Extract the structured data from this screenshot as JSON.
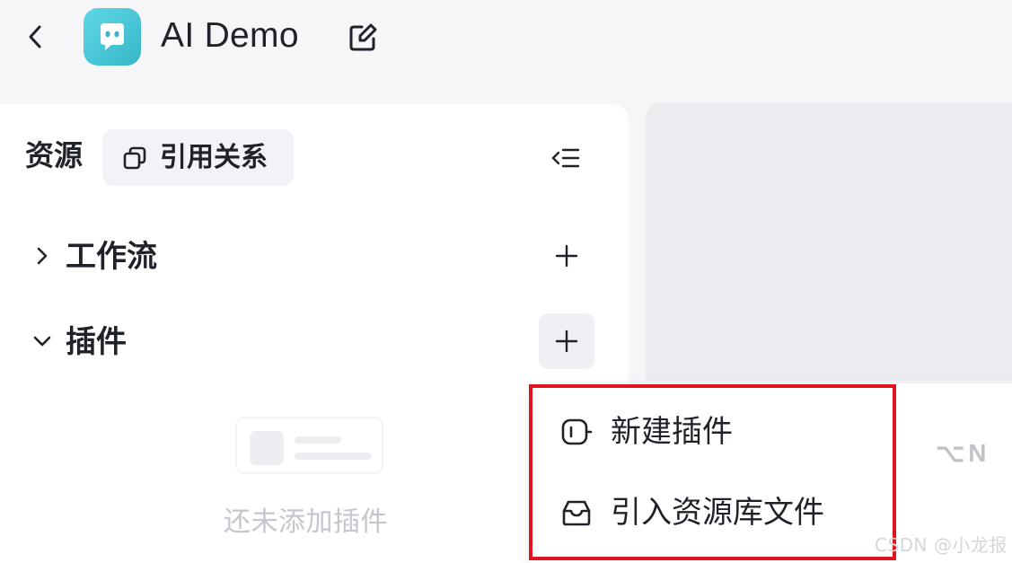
{
  "header": {
    "app_title": "AI Demo",
    "back_icon": "chevron-left-icon",
    "logo_icon": "chat-bot-logo",
    "edit_icon": "edit-icon"
  },
  "sidebar": {
    "title": "资源",
    "reference_button": {
      "label": "引用关系",
      "icon": "copy-link-icon"
    },
    "collapse_icon": "collapse-list-icon",
    "sections": [
      {
        "label": "工作流",
        "expanded": false,
        "add_icon": "plus-icon"
      },
      {
        "label": "插件",
        "expanded": true,
        "add_icon": "plus-icon"
      }
    ],
    "empty_state": {
      "text": "还未添加插件"
    }
  },
  "dropdown": {
    "items": [
      {
        "label": "新建插件",
        "icon": "plug-icon",
        "shortcut": "⌥N"
      },
      {
        "label": "引入资源库文件",
        "icon": "inbox-icon"
      }
    ]
  },
  "watermark": "CSDN @小龙报",
  "colors": {
    "accent_logo": "#36b6c8",
    "highlight": "#e0141f",
    "muted_text": "#c3c6cc"
  }
}
